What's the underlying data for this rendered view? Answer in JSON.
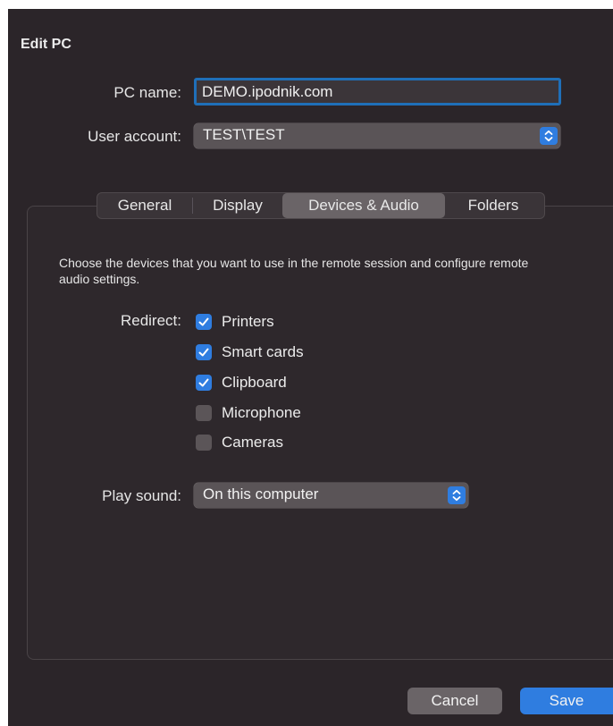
{
  "dialog": {
    "title": "Edit PC"
  },
  "form": {
    "pc_name_label": "PC name:",
    "pc_name_value": "DEMO.ipodnik.com",
    "user_account_label": "User account:",
    "user_account_value": "TEST\\TEST"
  },
  "tabs": [
    {
      "label": "General",
      "active": false
    },
    {
      "label": "Display",
      "active": false
    },
    {
      "label": "Devices & Audio",
      "active": true
    },
    {
      "label": "Folders",
      "active": false
    }
  ],
  "devices": {
    "description": "Choose the devices that you want to use in the remote session and configure remote audio settings.",
    "redirect_label": "Redirect:",
    "options": [
      {
        "label": "Printers",
        "checked": true
      },
      {
        "label": "Smart cards",
        "checked": true
      },
      {
        "label": "Clipboard",
        "checked": true
      },
      {
        "label": "Microphone",
        "checked": false
      },
      {
        "label": "Cameras",
        "checked": false
      }
    ],
    "play_sound_label": "Play sound:",
    "play_sound_value": "On this computer"
  },
  "buttons": {
    "cancel": "Cancel",
    "save": "Save"
  },
  "colors": {
    "accent": "#2f7de0",
    "background": "#2b2529",
    "focus_ring": "#1f6fb8"
  }
}
